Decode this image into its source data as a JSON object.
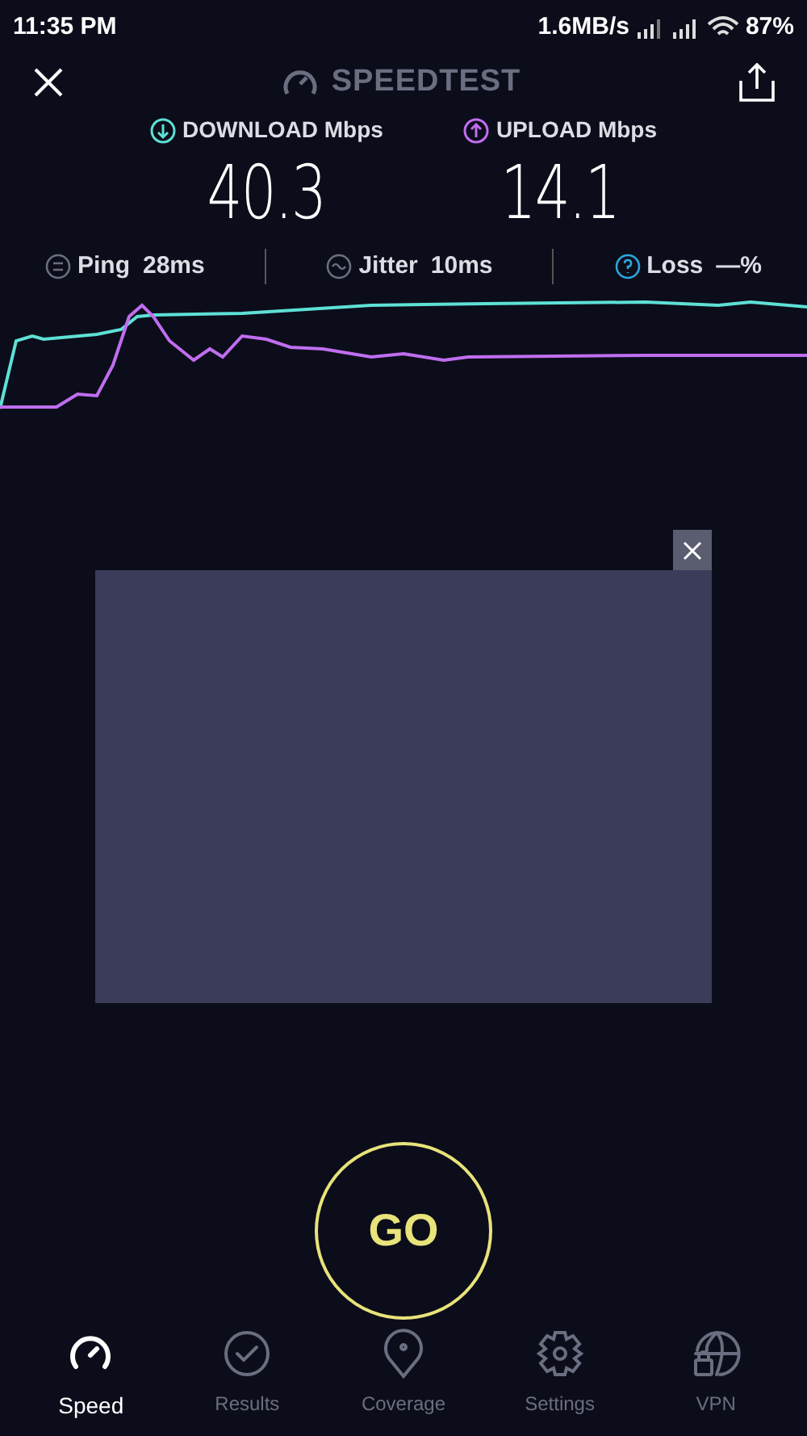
{
  "status_bar": {
    "time": "11:35 PM",
    "speed": "1.6MB/s",
    "battery": "87%"
  },
  "header": {
    "title": "SPEEDTEST"
  },
  "results": [
    {
      "kind": "download",
      "label": "DOWNLOAD Mbps",
      "value": "40.3",
      "color": "#5ee0d6"
    },
    {
      "kind": "upload",
      "label": "UPLOAD Mbps",
      "value": "14.1",
      "color": "#c06ef0"
    }
  ],
  "metrics": [
    {
      "kind": "ping",
      "label": "Ping",
      "value": "28ms"
    },
    {
      "kind": "jitter",
      "label": "Jitter",
      "value": "10ms"
    },
    {
      "kind": "loss",
      "label": "Loss",
      "value": "—%"
    }
  ],
  "go_button": {
    "label": "GO"
  },
  "tabs": [
    {
      "kind": "speed",
      "label": "Speed",
      "selected": true
    },
    {
      "kind": "results",
      "label": "Results",
      "selected": false
    },
    {
      "kind": "coverage",
      "label": "Coverage",
      "selected": false
    },
    {
      "kind": "settings",
      "label": "Settings",
      "selected": false
    },
    {
      "kind": "vpn",
      "label": "VPN",
      "selected": false
    }
  ]
}
